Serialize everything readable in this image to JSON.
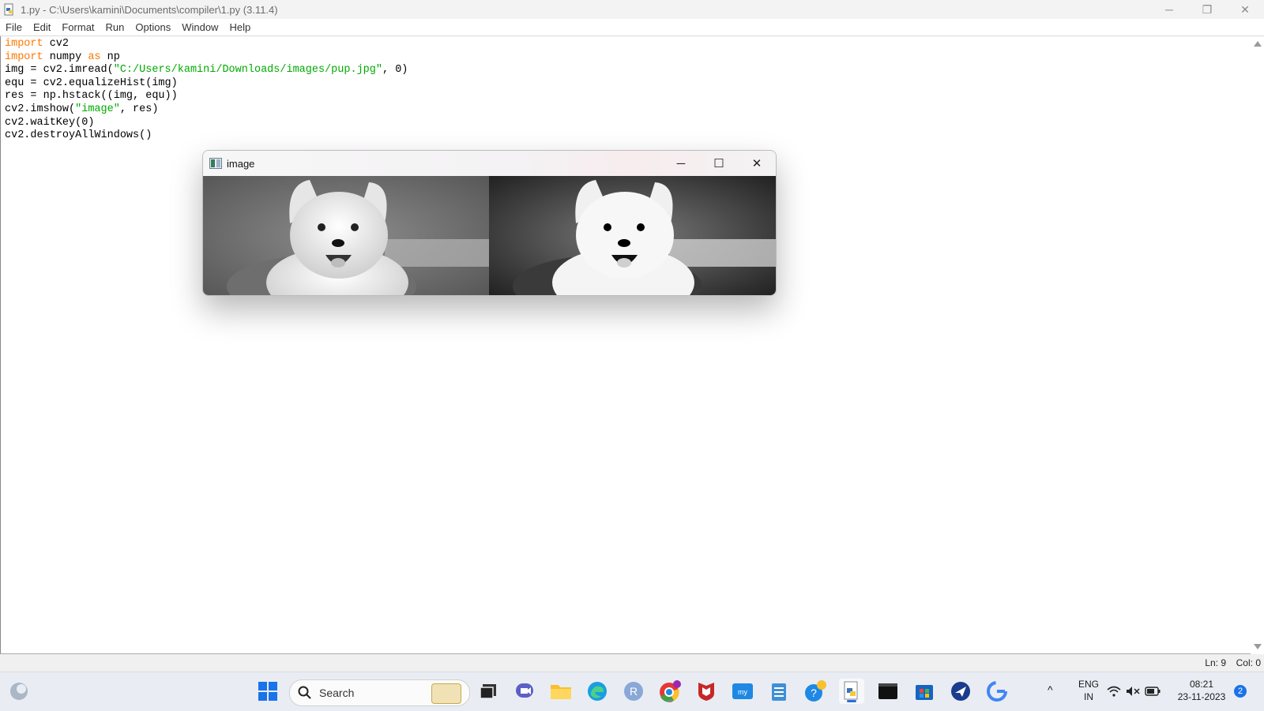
{
  "window": {
    "title": "1.py - C:\\Users\\kamini\\Documents\\compiler\\1.py (3.11.4)",
    "minimize": "─",
    "restore": "❐",
    "close": "✕"
  },
  "menu": [
    "File",
    "Edit",
    "Format",
    "Run",
    "Options",
    "Window",
    "Help"
  ],
  "code": {
    "l1_kw": "import",
    "l1_rest": " cv2",
    "l2_kw": "import",
    "l2_mid": " numpy ",
    "l2_kw2": "as",
    "l2_rest": " np",
    "l3_a": "img = cv2.imread(",
    "l3_str": "\"C:/Users/kamini/Downloads/images/pup.jpg\"",
    "l3_b": ", 0)",
    "l4": "equ = cv2.equalizeHist(img)",
    "l5": "res = np.hstack((img, equ))",
    "l6_a": "cv2.imshow(",
    "l6_str": "\"image\"",
    "l6_b": ", res)",
    "l7": "cv2.waitKey(0)",
    "l8": "cv2.destroyAllWindows()"
  },
  "status": {
    "ln": "Ln: 9",
    "col": "Col: 0"
  },
  "popup": {
    "title": "image",
    "minimize": "─",
    "maximize": "☐",
    "close": "✕"
  },
  "taskbar": {
    "search_placeholder": "Search",
    "lang_top": "ENG",
    "lang_bottom": "IN",
    "time": "08:21",
    "date": "23-11-2023",
    "notifications": "2",
    "chevron": "^"
  },
  "colors": {
    "keyword": "#ff7700",
    "string": "#00aa00",
    "accent": "#2a6fdb"
  }
}
